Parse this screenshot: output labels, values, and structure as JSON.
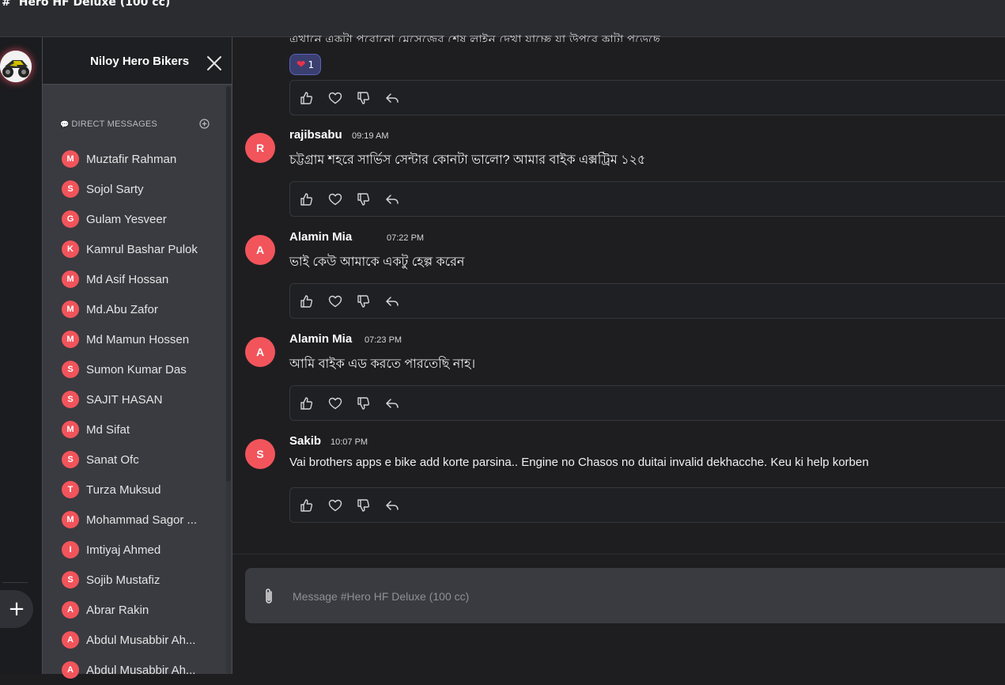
{
  "channel": {
    "hash": "#",
    "title": "Hero HF Deluxe (100 cc)"
  },
  "server": {
    "name": "Niloy Hero Bikers"
  },
  "direct_messages": {
    "header": "DIRECT MESSAGES",
    "items": [
      {
        "initial": "M",
        "name": "Muztafir Rahman"
      },
      {
        "initial": "S",
        "name": "Sojol Sarty"
      },
      {
        "initial": "G",
        "name": "Gulam Yesveer"
      },
      {
        "initial": "K",
        "name": "Kamrul Bashar Pulok"
      },
      {
        "initial": "M",
        "name": "Md Asif Hossan"
      },
      {
        "initial": "M",
        "name": "Md.Abu Zafor"
      },
      {
        "initial": "M",
        "name": "Md Mamun Hossen"
      },
      {
        "initial": "S",
        "name": "Sumon Kumar Das"
      },
      {
        "initial": "S",
        "name": "SAJIT HASAN"
      },
      {
        "initial": "M",
        "name": "Md Sifat"
      },
      {
        "initial": "S",
        "name": "Sanat Ofc"
      },
      {
        "initial": "T",
        "name": "Turza Muksud"
      },
      {
        "initial": "M",
        "name": "Mohammad Sagor ..."
      },
      {
        "initial": "I",
        "name": "Imtiyaj Ahmed"
      },
      {
        "initial": "S",
        "name": "Sojib Mustafiz"
      },
      {
        "initial": "A",
        "name": "Abrar Rakin"
      },
      {
        "initial": "A",
        "name": "Abdul Musabbir Ah..."
      },
      {
        "initial": "A",
        "name": "Abdul Musabbir Ah..."
      }
    ]
  },
  "top_reaction": {
    "emoji": "❤",
    "count": "1"
  },
  "messages": [
    {
      "initial": "R",
      "author": "rajibsabu",
      "time": "09:19 AM",
      "text": "চট্টগ্রাম শহরে সার্ভিস সেন্টার কোনটা ভালো? আমার বাইক এক্সট্রিম ১২৫"
    },
    {
      "initial": "A",
      "author": "Alamin Mia",
      "time": "07:22 PM",
      "text": "ভাই কেউ আমাকে একটু হেল্প করেন"
    },
    {
      "initial": "A",
      "author": "Alamin Mia",
      "time": "07:23 PM",
      "text": "আমি বাইক এড করতে পারতেছি নাহ।"
    },
    {
      "initial": "S",
      "author": "Sakib",
      "time": "10:07 PM",
      "text": "Vai brothers apps e bike add korte parsina.. Engine no Chasos no duitai invalid dekhacche. Keu ki help korben"
    }
  ],
  "composer": {
    "placeholder": "Message #Hero HF Deluxe (100 cc)"
  },
  "colors": {
    "accent": "#f2545b",
    "background": "#1e1e21",
    "sidebar": "#3a3b40"
  }
}
